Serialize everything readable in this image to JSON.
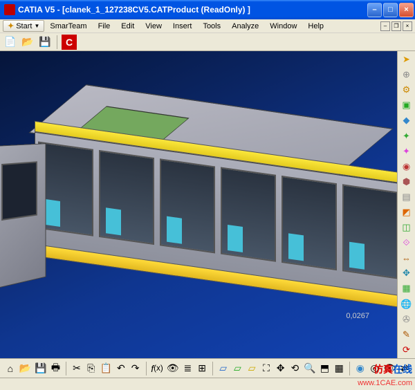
{
  "window": {
    "title": "CATIA V5 - [clanek_1_127238CV5.CATProduct (ReadOnly) ]"
  },
  "menubar": {
    "start": "Start",
    "items": [
      "SmarTeam",
      "File",
      "Edit",
      "View",
      "Insert",
      "Tools",
      "Analyze",
      "Window",
      "Help"
    ]
  },
  "toolbar_top": {
    "icons": [
      "new-doc",
      "open",
      "save",
      "separator",
      "catia-c"
    ]
  },
  "toolbar_right": {
    "icons": [
      "select-arrow",
      "compass",
      "assembly",
      "product",
      "component",
      "axis-green",
      "axis-pink",
      "geometry",
      "clash",
      "section",
      "cut-section",
      "measures",
      "measure-item",
      "measure-between",
      "snap",
      "constraint",
      "update-sep",
      "universal",
      "robot",
      "sep",
      "3d-annotate",
      "update"
    ]
  },
  "toolbar_bottom": {
    "icons": [
      "home",
      "open",
      "save-all",
      "print",
      "separator",
      "cut",
      "copy",
      "paste",
      "undo",
      "redo",
      "separator",
      "fx",
      "measure",
      "tree",
      "grid",
      "separator",
      "plane-blue",
      "plane-green",
      "plane-yellow",
      "zoom-fit",
      "pan",
      "rotate",
      "zoom",
      "normal-view",
      "multi-view",
      "separator",
      "render1",
      "render2",
      "render3",
      "hide",
      "swap"
    ]
  },
  "viewport": {
    "coords": "0,0267"
  },
  "watermark": {
    "text1": "仿真",
    "text2": "在线",
    "url": "www.1CAE.com"
  }
}
